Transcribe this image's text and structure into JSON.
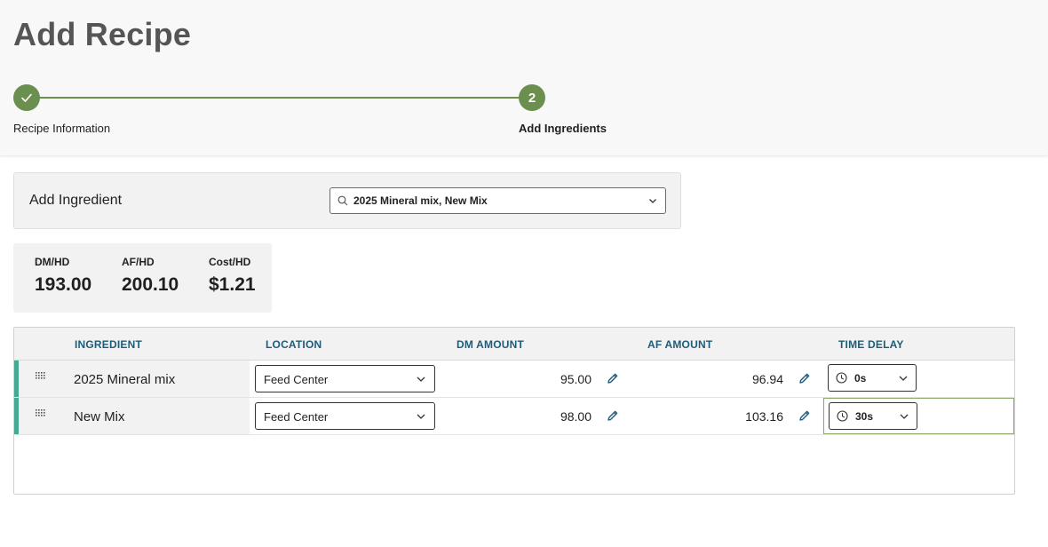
{
  "page": {
    "title": "Add Recipe"
  },
  "stepper": {
    "steps": [
      {
        "number": "1",
        "label": "Recipe Information",
        "status": "complete"
      },
      {
        "number": "2",
        "label": "Add Ingredients",
        "status": "active"
      }
    ],
    "accent_color": "#6b8f4e"
  },
  "add_ingredient": {
    "label": "Add Ingredient",
    "selected_value": "2025 Mineral mix, New Mix"
  },
  "stats": [
    {
      "label": "DM/HD",
      "value": "193.00"
    },
    {
      "label": "AF/HD",
      "value": "200.10"
    },
    {
      "label": "Cost/HD",
      "value": "$1.21"
    }
  ],
  "table": {
    "headers": {
      "ingredient": "INGREDIENT",
      "location": "LOCATION",
      "dm_amount": "DM AMOUNT",
      "af_amount": "AF AMOUNT",
      "time_delay": "TIME DELAY"
    },
    "rows": [
      {
        "ingredient": "2025 Mineral mix",
        "location": "Feed Center",
        "dm_amount": "95.00",
        "af_amount": "96.94",
        "time_delay": "0s"
      },
      {
        "ingredient": "New Mix",
        "location": "Feed Center",
        "dm_amount": "98.00",
        "af_amount": "103.16",
        "time_delay": "30s"
      }
    ],
    "header_color": "#1d5c7a",
    "row_accent_color": "#46a890"
  }
}
